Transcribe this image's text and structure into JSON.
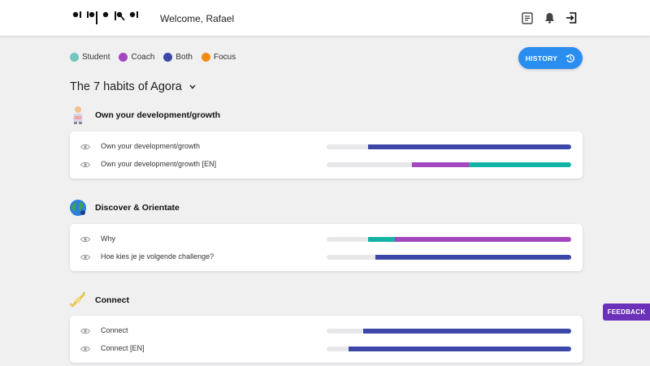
{
  "header": {
    "logo_text": "a person a dialog",
    "welcome": "Welcome, Rafael",
    "icons": [
      "notes-icon",
      "bell-icon",
      "logout-icon"
    ]
  },
  "legend": [
    {
      "label": "Student",
      "color": "#74c6be"
    },
    {
      "label": "Coach",
      "color": "#a347bf"
    },
    {
      "label": "Both",
      "color": "#3c47a8"
    },
    {
      "label": "Focus",
      "color": "#f28b14"
    }
  ],
  "history_button": {
    "label": "HISTORY",
    "color": "#2a8df0"
  },
  "program": {
    "title": "The 7 habits of Agora"
  },
  "habits": [
    {
      "title": "Own your development/growth",
      "icon": "person-growth-icon",
      "items": [
        {
          "label": "Own your development/growth",
          "segments": [
            {
              "from": 0.17,
              "to": 1.0,
              "color": "#3c47a8"
            }
          ]
        },
        {
          "label": "Own your development/growth [EN]",
          "segments": [
            {
              "from": 0.35,
              "to": 0.58,
              "color": "#a347bf"
            },
            {
              "from": 0.58,
              "to": 1.0,
              "color": "#15b3a6"
            }
          ]
        }
      ]
    },
    {
      "title": "Discover & Orientate",
      "icon": "globe-icon",
      "items": [
        {
          "label": "Why",
          "segments": [
            {
              "from": 0.17,
              "to": 0.28,
              "color": "#15b3a6"
            },
            {
              "from": 0.28,
              "to": 1.0,
              "color": "#a347bf"
            }
          ]
        },
        {
          "label": "Hoe kies je je volgende challenge?",
          "segments": [
            {
              "from": 0.2,
              "to": 1.0,
              "color": "#3c47a8"
            }
          ]
        }
      ]
    },
    {
      "title": "Connect",
      "icon": "plug-icon",
      "items": [
        {
          "label": "Connect",
          "segments": [
            {
              "from": 0.15,
              "to": 1.0,
              "color": "#3c47a8"
            }
          ]
        },
        {
          "label": "Connect [EN]",
          "segments": [
            {
              "from": 0.09,
              "to": 1.0,
              "color": "#3c47a8"
            }
          ]
        }
      ]
    }
  ],
  "feedback": {
    "label": "FEEDBACK",
    "color": "#6b31b8"
  }
}
